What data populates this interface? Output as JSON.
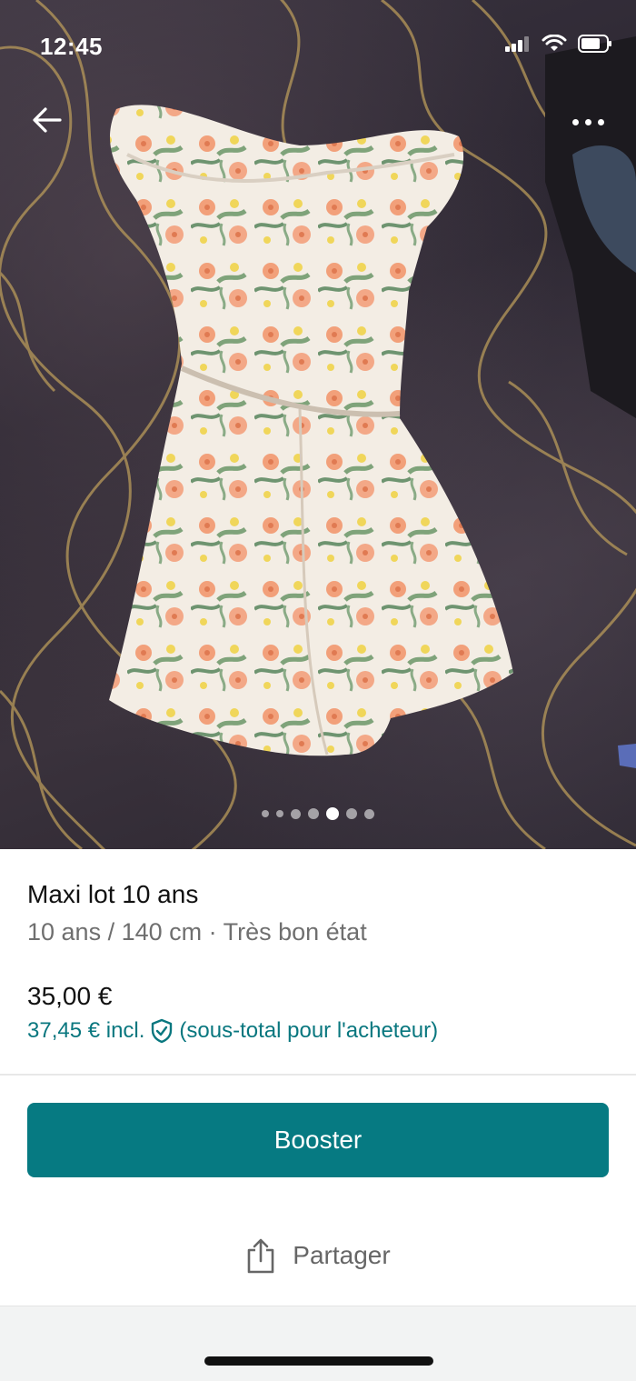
{
  "status_bar": {
    "time": "12:45"
  },
  "gallery": {
    "photo_count": 7,
    "active_index": 4
  },
  "listing": {
    "title": "Maxi lot 10 ans",
    "subtitle": "10 ans / 140 cm · Très bon état",
    "price": "35,00 €",
    "buyer_price": "37,45 € incl.",
    "buyer_note": "(sous-total pour l'acheteur)"
  },
  "actions": {
    "booster_label": "Booster",
    "share_label": "Partager"
  },
  "colors": {
    "accent": "#067a82",
    "accent_text": "#09777f"
  },
  "icons": [
    "back-arrow-icon",
    "more-options-icon",
    "shield-check-icon",
    "share-icon",
    "signal-icon",
    "wifi-icon",
    "battery-icon"
  ]
}
